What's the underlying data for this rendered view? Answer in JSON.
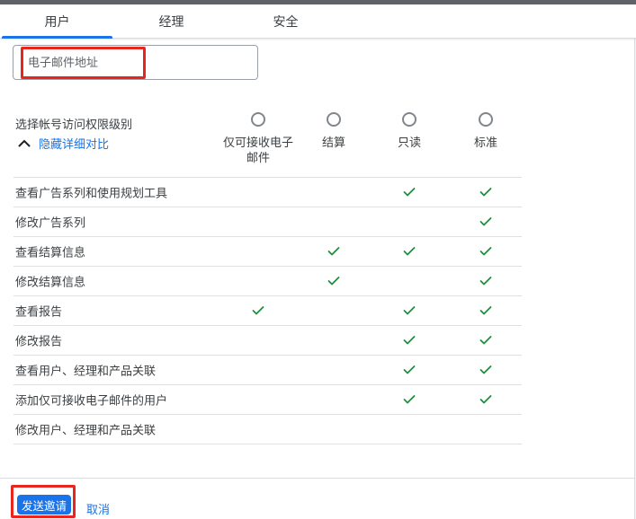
{
  "tabs": [
    {
      "id": "users",
      "label": "用户",
      "active": true
    },
    {
      "id": "managers",
      "label": "经理",
      "active": false
    },
    {
      "id": "security",
      "label": "安全",
      "active": false
    }
  ],
  "email_input": {
    "placeholder": "电子邮件地址",
    "value": ""
  },
  "access_section": {
    "label": "选择帐号访问权限级别",
    "toggle_link": "隐藏详细对比",
    "toggle_icon": "chevron-up-icon",
    "levels": [
      {
        "id": "email-only",
        "label": "仅可接收电子邮件",
        "selected": false
      },
      {
        "id": "billing",
        "label": "结算",
        "selected": false
      },
      {
        "id": "read-only",
        "label": "只读",
        "selected": false
      },
      {
        "id": "standard",
        "label": "标准",
        "selected": false
      }
    ]
  },
  "permissions_table": {
    "check_icon": "check-icon",
    "rows": [
      {
        "label": "查看广告系列和使用规划工具",
        "checks": [
          false,
          false,
          true,
          true
        ]
      },
      {
        "label": "修改广告系列",
        "checks": [
          false,
          false,
          false,
          true
        ]
      },
      {
        "label": "查看结算信息",
        "checks": [
          false,
          true,
          true,
          true
        ]
      },
      {
        "label": "修改结算信息",
        "checks": [
          false,
          true,
          false,
          true
        ]
      },
      {
        "label": "查看报告",
        "checks": [
          true,
          false,
          true,
          true
        ]
      },
      {
        "label": "修改报告",
        "checks": [
          false,
          false,
          true,
          true
        ]
      },
      {
        "label": "查看用户、经理和产品关联",
        "checks": [
          false,
          false,
          true,
          true
        ]
      },
      {
        "label": "添加仅可接收电子邮件的用户",
        "checks": [
          false,
          false,
          true,
          true
        ]
      },
      {
        "label": "修改用户、经理和产品关联",
        "checks": [
          false,
          false,
          false,
          false
        ]
      }
    ]
  },
  "footer": {
    "send_button": "发送邀请",
    "cancel_link": "取消"
  },
  "annotations": [
    {
      "id": "email-field-highlight",
      "shape": "red-box"
    },
    {
      "id": "send-button-highlight",
      "shape": "red-box"
    }
  ],
  "colors": {
    "accent_blue": "#1a73e8",
    "check_green": "#1e8e3e",
    "annotation_red": "#e8261d",
    "topbar_gray": "#5f6368",
    "border_gray": "#dadce0",
    "row_border": "#e0e0e0",
    "text_dark": "#3c4043"
  }
}
